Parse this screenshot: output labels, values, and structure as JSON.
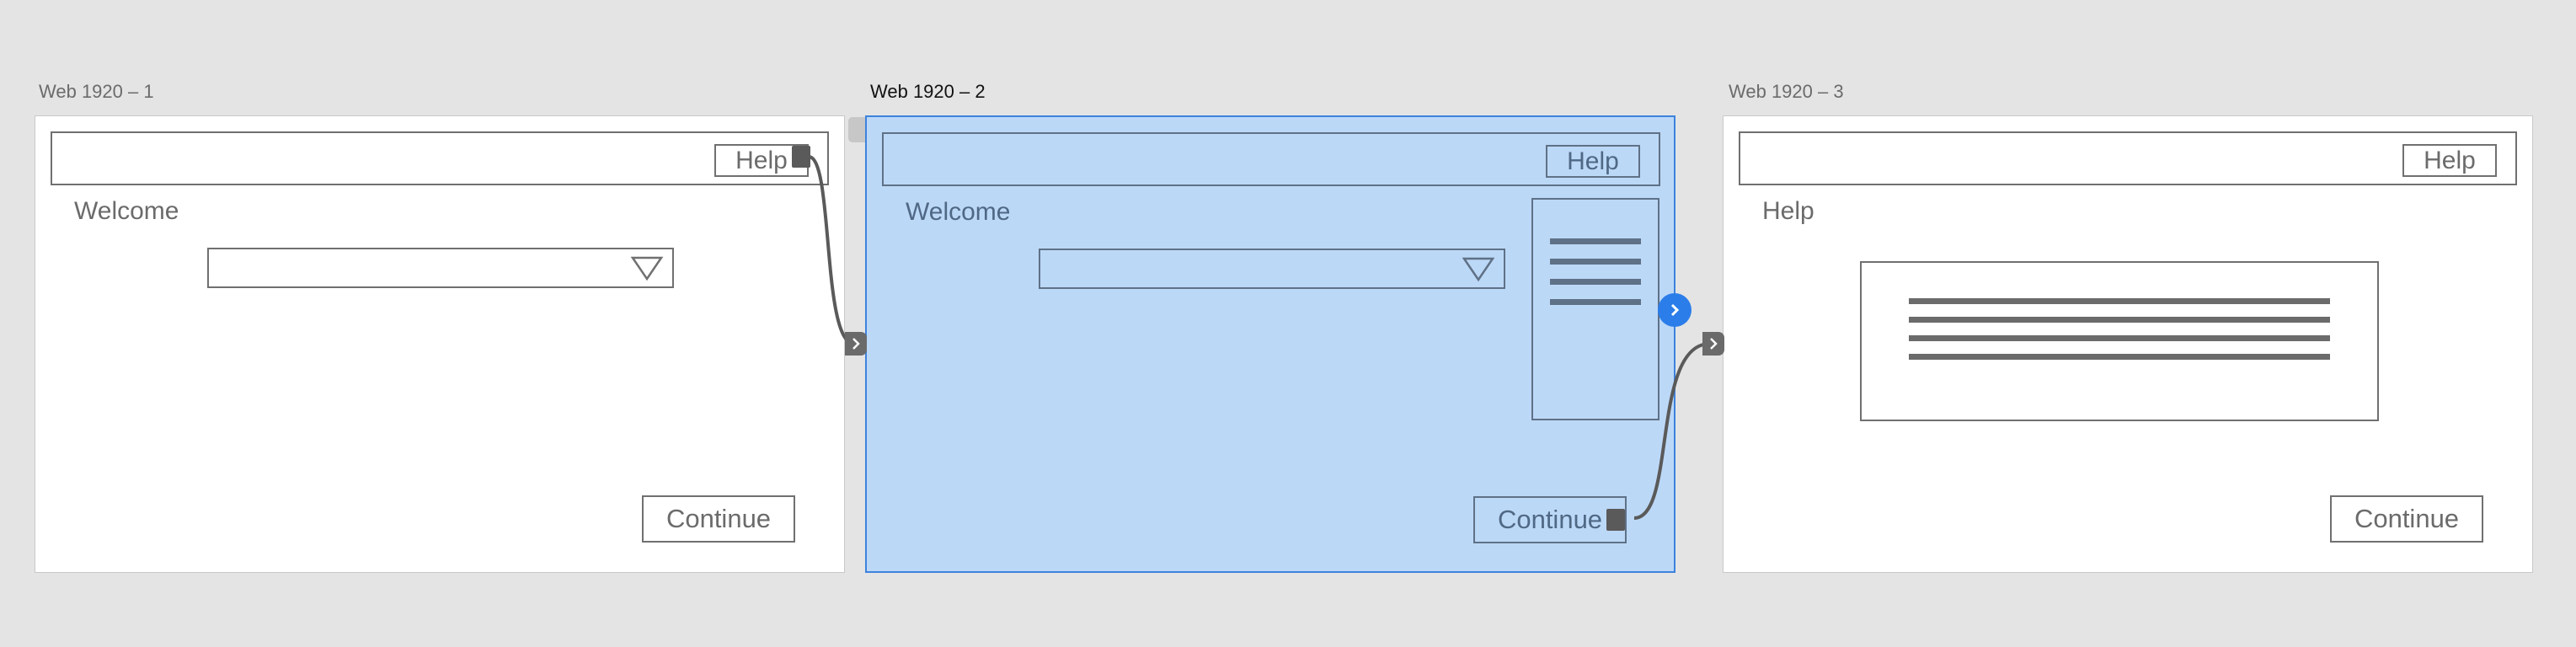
{
  "artboards": [
    {
      "label": "Web 1920 – 1",
      "help": "Help",
      "heading": "Welcome",
      "continue": "Continue"
    },
    {
      "label": "Web 1920 – 2",
      "help": "Help",
      "heading": "Welcome",
      "continue": "Continue",
      "selected": true
    },
    {
      "label": "Web 1920 – 3",
      "help": "Help",
      "heading": "Help",
      "continue": "Continue"
    }
  ],
  "colors": {
    "canvas": "#e4e4e4",
    "selection_fill": "#bcd8f7",
    "selection_border": "#3d82dd",
    "wire": "#5a5a5a",
    "arrow_badge": "#2b7de9"
  },
  "icons": [
    "dropdown-triangle-icon",
    "hamburger-lines-icon",
    "chevron-right-icon"
  ]
}
